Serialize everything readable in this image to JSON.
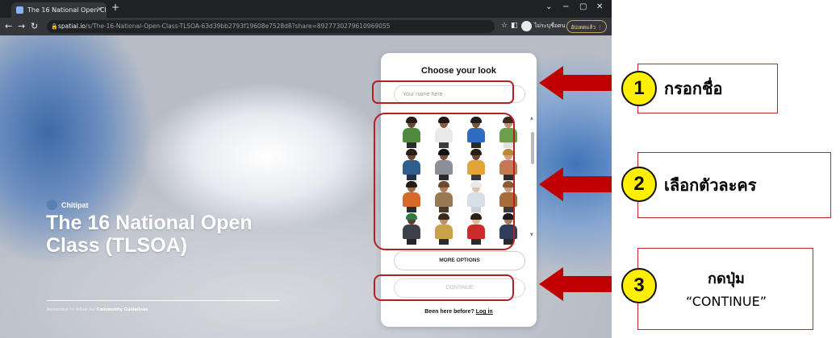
{
  "browser": {
    "tab_title": "The 16 National Open Class (TLS",
    "tab_close": "×",
    "new_tab": "+",
    "url_host": "spatial.io",
    "url_path": "/s/The-16-National-Open-Class-TLSOA-63d39bb2793f19608e7528d8?share=8927730279610969055",
    "profile_label": "ไม่ระบุชื่อตน",
    "update_label": "อัปเดตแล้ว  ⋮"
  },
  "scene": {
    "host_name": "Chitipat",
    "room_title": "The 16 National Open Class (TLSOA)",
    "guidelines_prefix": "Remember to follow our",
    "guidelines_link": "Community Guidelines"
  },
  "panel": {
    "title": "Choose your look",
    "name_placeholder": "Your name here",
    "more_options": "MORE OPTIONS",
    "continue": "CONTINUE",
    "been_here": "Been here before?",
    "log_in": "Log in"
  },
  "avatars": [
    {
      "skin": "#6b4a34",
      "hair": "#2a1c14",
      "top": "#4f8a3f",
      "legs": "#2b2b2b"
    },
    {
      "skin": "#8a5a3c",
      "hair": "#1f1712",
      "top": "#e9e9e9",
      "legs": "#3b3b3b"
    },
    {
      "skin": "#7a5236",
      "hair": "#1d1d1d",
      "top": "#2f6bc0",
      "legs": "#2a2a2a"
    },
    {
      "skin": "#c48e6a",
      "hair": "#3b2a1c",
      "top": "#6aa04a",
      "legs": "#e0e0e0"
    },
    {
      "skin": "#6a4632",
      "hair": "#2a1d14",
      "top": "#2e5d8e",
      "legs": "#23304a"
    },
    {
      "skin": "#7b5038",
      "hair": "#121212",
      "top": "#8a8f9a",
      "legs": "#2b2b2b"
    },
    {
      "skin": "#6e4834",
      "hair": "#2c1e15",
      "top": "#e4a43a",
      "legs": "#3a3a3a"
    },
    {
      "skin": "#d3a07e",
      "hair": "#b98a3e",
      "top": "#c47a52",
      "legs": "#2d2d2d"
    },
    {
      "skin": "#a06a4a",
      "hair": "#241a12",
      "top": "#d66a2a",
      "legs": "#2b2b2b"
    },
    {
      "skin": "#b07a5a",
      "hair": "#6e4a2e",
      "top": "#9a7a52",
      "legs": "#4a3a2a"
    },
    {
      "skin": "#e0c2a8",
      "hair": "#e9e9e9",
      "top": "#d9dfe6",
      "legs": "#c9d1da"
    },
    {
      "skin": "#c99a78",
      "hair": "#8a5a32",
      "top": "#a86c3a",
      "legs": "#3a3a3a"
    },
    {
      "skin": "#5e3e2c",
      "hair": "#2f7a3f",
      "top": "#3c4048",
      "legs": "#262626"
    },
    {
      "skin": "#c48a64",
      "hair": "#3a2a1c",
      "top": "#c9a24a",
      "legs": "#2b2b2b"
    },
    {
      "skin": "#e2b896",
      "hair": "#2b1f16",
      "top": "#cc2b2b",
      "legs": "#2a2a2a"
    },
    {
      "skin": "#a87a5a",
      "hair": "#1a1a1a",
      "top": "#2f3e5e",
      "legs": "#2a2a2a"
    }
  ],
  "annotations": {
    "step1": {
      "number": "1",
      "label": "กรอกชื่อ"
    },
    "step2": {
      "number": "2",
      "label": "เลือกตัวละคร"
    },
    "step3": {
      "number": "3",
      "label_line1": "กดปุ่ม",
      "label_line2": "“CONTINUE”"
    },
    "highlight_color": "#b22020",
    "arrow_color": "#c00000",
    "badge_color": "#ffef00"
  }
}
